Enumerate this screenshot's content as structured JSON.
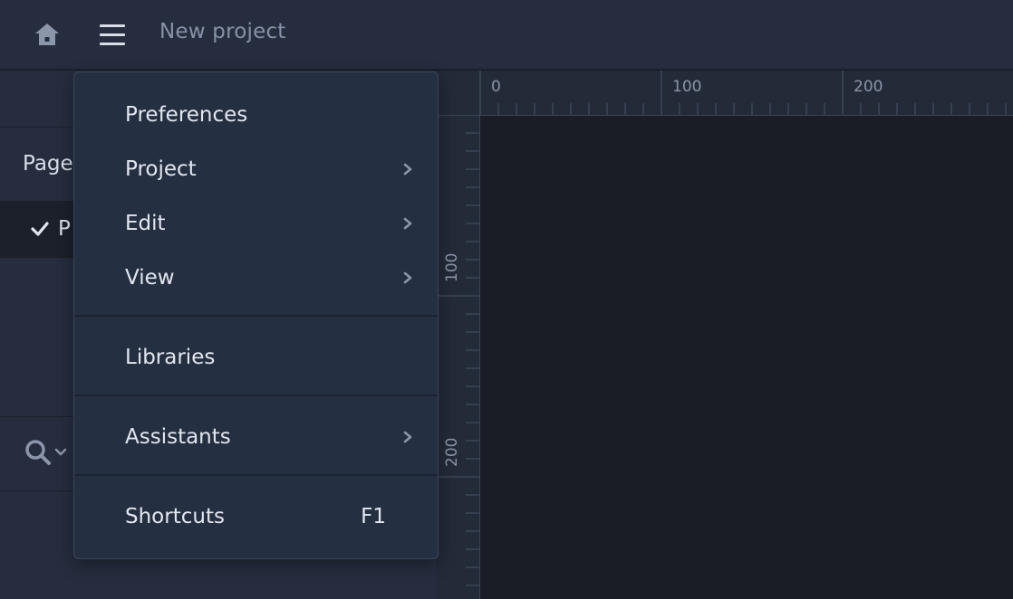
{
  "header": {
    "home_icon": "home-icon",
    "menu_icon": "hamburger-icon",
    "project_title": "New project"
  },
  "sidebar": {
    "pages_label": "Page",
    "page_item_label": "P",
    "page_item_checked": true,
    "search_icon": "search-icon"
  },
  "rulers": {
    "top": [
      "0",
      "100",
      "200"
    ],
    "left": [
      "100",
      "200"
    ]
  },
  "menu": {
    "items": [
      {
        "label": "Preferences",
        "submenu": false
      },
      {
        "label": "Project",
        "submenu": true
      },
      {
        "label": "Edit",
        "submenu": true
      },
      {
        "label": "View",
        "submenu": true
      },
      {
        "label": "Libraries",
        "submenu": false
      },
      {
        "label": "Assistants",
        "submenu": true
      },
      {
        "label": "Shortcuts",
        "submenu": false,
        "shortcut": "F1"
      }
    ]
  },
  "colors": {
    "header_bg": "#252d3e",
    "menu_bg": "#252f42",
    "canvas_bg": "#1a1d25",
    "text": "#e2e6ee"
  }
}
